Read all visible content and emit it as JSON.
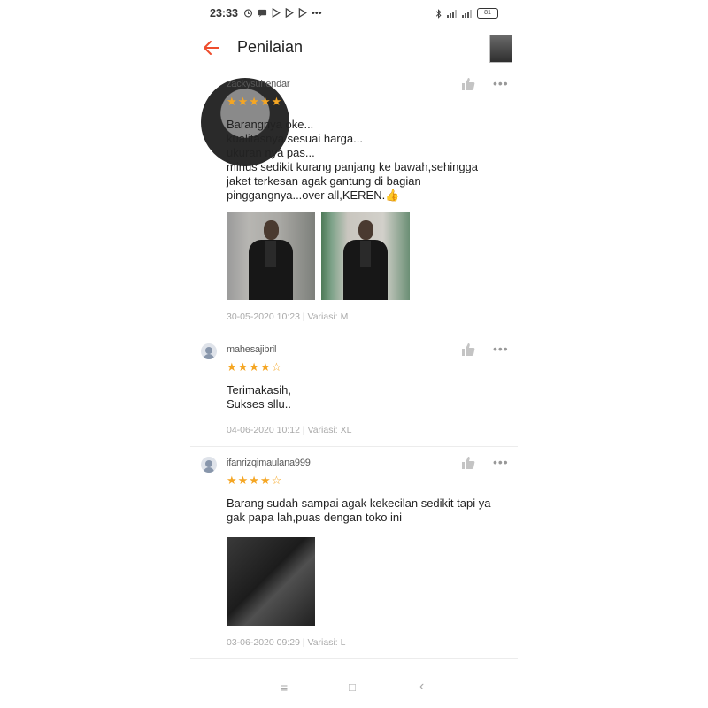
{
  "status_bar": {
    "time": "23:33",
    "battery": "81",
    "left_icons": [
      "alarm-icon",
      "message-icon",
      "play-icon",
      "play-icon",
      "play-icon",
      "more-dots"
    ],
    "right_icons": [
      "bluetooth-icon",
      "signal-icon",
      "signal-icon",
      "battery-icon"
    ]
  },
  "header": {
    "title": "Penilaian",
    "back_icon": "arrow-left-icon",
    "accent_color": "#ee4d2d"
  },
  "reviews": [
    {
      "username": "zackysuhendar",
      "rating": 5,
      "stars": "★★★★★",
      "comment": [
        "Barangnya oke...",
        "kualitasnya sesuai harga...",
        "ukuran nya pas...",
        "minus sedikit kurang panjang ke bawah,sehingga",
        "jaket terkesan agak gantung di bagian",
        "pinggangnya...over all,KEREN.👍"
      ],
      "footer": "30-05-2020 10:23 | Variasi: M"
    },
    {
      "username": "mahesajibril",
      "rating": 4,
      "stars": "★★★★☆",
      "comment": [
        "Terimakasih,",
        "Sukses sllu.."
      ],
      "footer": "04-06-2020 10:12 | Variasi: XL"
    },
    {
      "username": "ifanrizqimaulana999",
      "rating": 4,
      "stars": "★★★★☆",
      "comment": [
        "Barang sudah sampai agak kekecilan sedikit tapi ya",
        "gak papa lah,puas dengan toko ini"
      ],
      "footer": "03-06-2020 09:29 | Variasi: L"
    }
  ],
  "nav_bar": {
    "menu": "≡",
    "home": "□",
    "back": "‹"
  },
  "colors": {
    "star": "#f5a623",
    "footer_text": "#aaaaaa"
  }
}
